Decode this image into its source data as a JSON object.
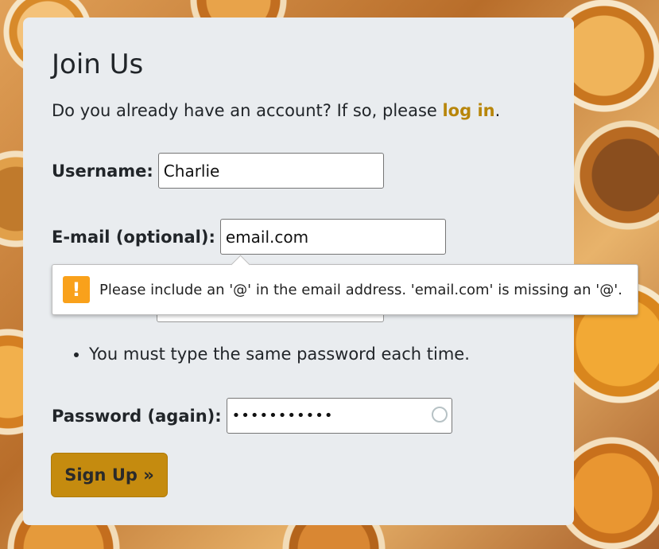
{
  "form": {
    "title": "Join Us",
    "intro_prefix": "Do you already have an account? If so, please ",
    "login_link": "log in",
    "intro_suffix": ".",
    "username_label": "Username:",
    "username_value": "Charlie",
    "email_label": "E-mail (optional):",
    "email_value": "email.com",
    "password_hint": "You must type the same password each time.",
    "password_again_label": "Password (again):",
    "password_again_value": "•••••••••••",
    "submit_label": "Sign Up »"
  },
  "tooltip": {
    "icon": "warning-icon",
    "text": "Please include an '@' in the email address. 'email.com' is missing an '@'."
  },
  "colors": {
    "accent": "#c58b0f",
    "link": "#b8860b",
    "card_bg": "#e9ecef",
    "warning": "#f9a11b"
  }
}
